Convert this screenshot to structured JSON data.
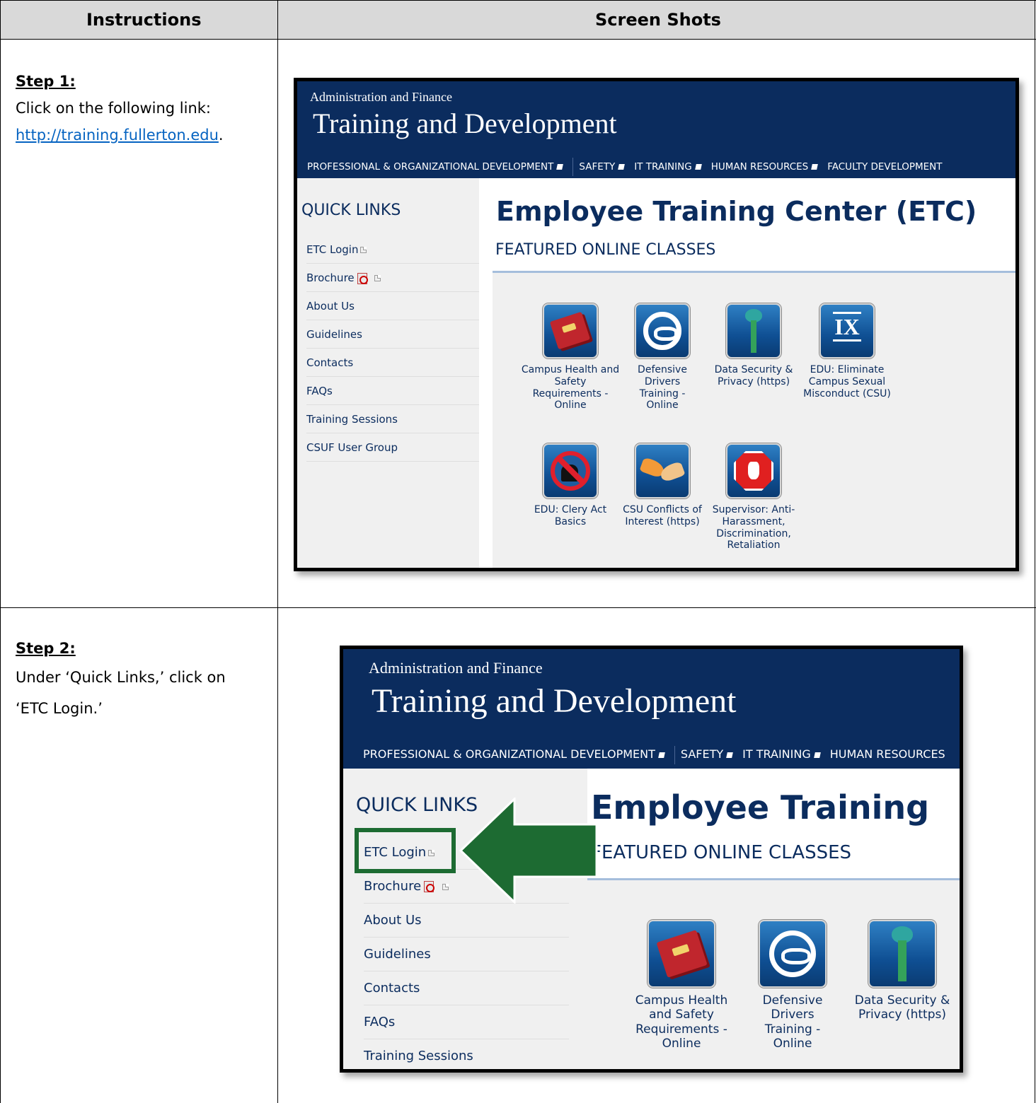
{
  "table": {
    "header_instructions": "Instructions",
    "header_screenshots": "Screen Shots"
  },
  "steps": [
    {
      "title": "Step 1:",
      "text": "Click on the following link:",
      "link": "http://training.fullerton.edu",
      "link_suffix": "."
    },
    {
      "title": "Step 2:",
      "text": "Under ‘Quick Links,’ click on ‘ETC Login.’"
    }
  ],
  "site": {
    "subtitle": "Administration and Finance",
    "title": "Training and Development",
    "nav": [
      "PROFESSIONAL & ORGANIZATIONAL DEVELOPMENT",
      "SAFETY",
      "IT TRAINING",
      "HUMAN RESOURCES",
      "FACULTY DEVELOPMENT"
    ],
    "quick_links_title": "QUICK LINKS",
    "quick_links": [
      "ETC Login",
      "Brochure",
      "About Us",
      "Guidelines",
      "Contacts",
      "FAQs",
      "Training Sessions",
      "CSUF User Group"
    ],
    "page_title": "Employee Training Center (ETC)",
    "page_title_cropped": "Employee Training",
    "section_title": "FEATURED ONLINE CLASSES",
    "courses": [
      {
        "label": "Campus Health and Safety Requirements - Online",
        "icon": "health-safety-book-icon"
      },
      {
        "label": "Defensive Drivers Training - Online",
        "icon": "steering-wheel-icon"
      },
      {
        "label": "Data Security & Privacy (https)",
        "icon": "key-icon"
      },
      {
        "label": "EDU: Eliminate Campus Sexual Misconduct (CSU)",
        "icon": "title-ix-icon"
      },
      {
        "label": "EDU: Clery Act Basics",
        "icon": "clery-icon"
      },
      {
        "label": "CSU Conflicts of Interest (https)",
        "icon": "handshake-icon"
      },
      {
        "label": "Supervisor: Anti-Harassment, Discrimination, Retaliation",
        "icon": "stop-hand-icon"
      }
    ],
    "ix_glyph": "IX"
  },
  "colors": {
    "banner": "#0b2c5e",
    "highlight": "#1d6b32",
    "link": "#0563c1"
  }
}
